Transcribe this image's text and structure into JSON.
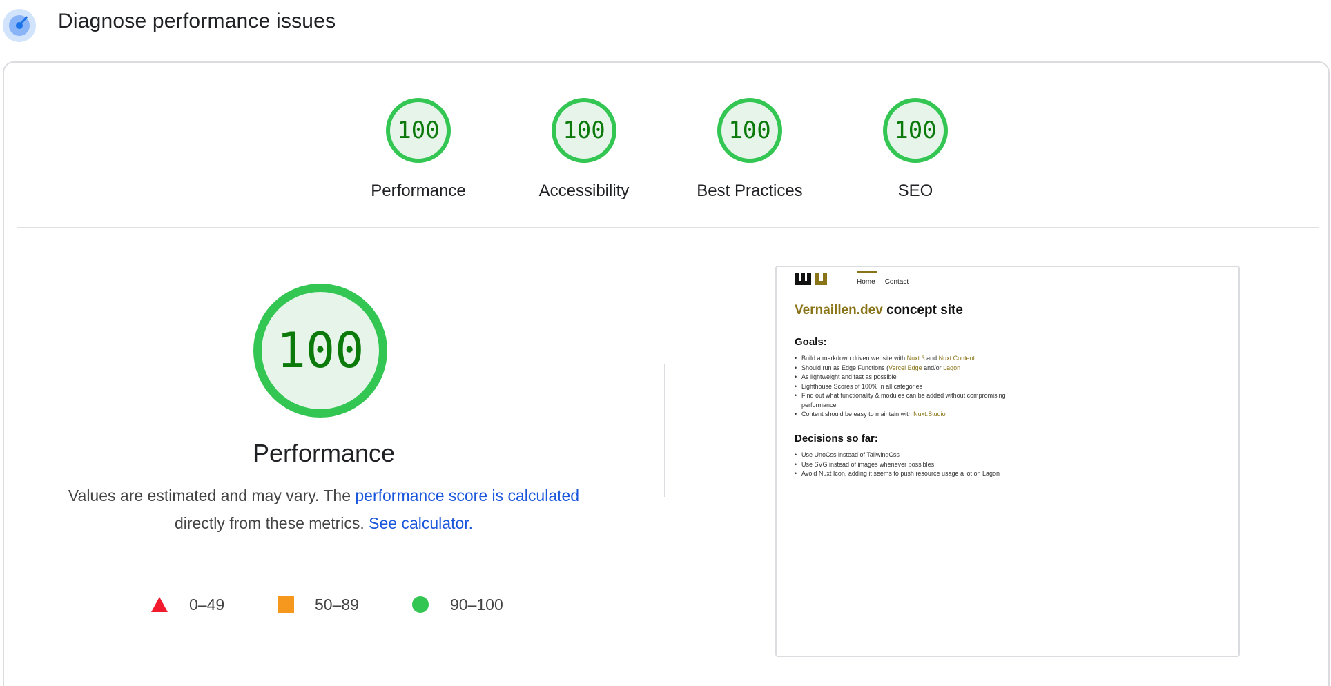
{
  "header": {
    "title": "Diagnose performance issues",
    "icon": "lighthouse-gauge-icon"
  },
  "categories": [
    {
      "score": "100",
      "label": "Performance"
    },
    {
      "score": "100",
      "label": "Accessibility"
    },
    {
      "score": "100",
      "label": "Best Practices"
    },
    {
      "score": "100",
      "label": "SEO"
    }
  ],
  "performance": {
    "score": "100",
    "title": "Performance",
    "desc_prefix": "Values are estimated and may vary. The ",
    "desc_link": "performance score is calculated",
    "desc_mid": " directly from these metrics. ",
    "calc_link": "See calculator."
  },
  "legend": {
    "fail": "0–49",
    "average": "50–89",
    "pass": "90–100"
  },
  "colors": {
    "pass": "#34c653",
    "pass_fill": "#e6f4ea",
    "pass_text": "#0b7a0b",
    "average": "#f6981e",
    "fail": "#f21b2d",
    "link": "#1a56db"
  },
  "screenshot": {
    "nav_home": "Home",
    "nav_contact": "Contact",
    "title_brand": "Vernaillen.dev",
    "title_rest": " concept site",
    "goals_heading": "Goals:",
    "goals": [
      [
        "Build a markdown driven website with ",
        "Nuxt 3",
        " and ",
        "Nuxt Content"
      ],
      [
        "Should run as Edge Functions (",
        "Vercel Edge",
        " and/or ",
        "Lagon"
      ],
      [
        "As lightweight and fast as possible"
      ],
      [
        "Lighthouse Scores of 100% in all categories"
      ],
      [
        "Find out what functionality & modules can be added without compromising performance"
      ],
      [
        "Content should be easy to maintain with ",
        "Nuxt.Studio"
      ]
    ],
    "decisions_heading": "Decisions so far:",
    "decisions": [
      "Use UnoCss instead of TailwindCss",
      "Use SVG instead of images whenever possibles",
      "Avoid Nuxt Icon, adding it seems to push resource usage a lot on Lagon"
    ]
  }
}
